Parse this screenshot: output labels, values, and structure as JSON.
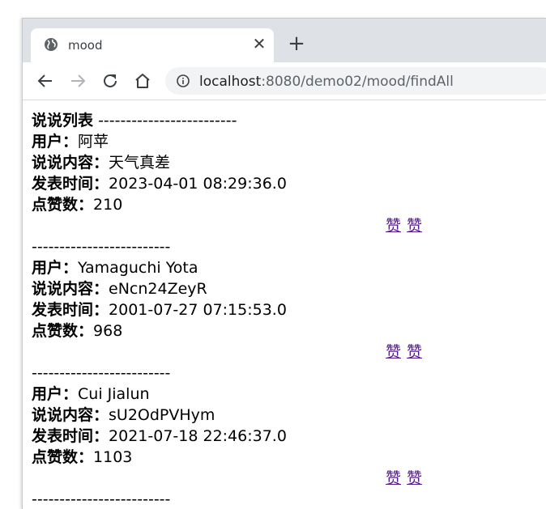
{
  "tab": {
    "title": "mood",
    "close_glyph": "✕",
    "new_tab_glyph": "+",
    "favicon": "globe-icon"
  },
  "toolbar": {
    "back_icon": "back-arrow-icon",
    "forward_icon": "forward-arrow-icon",
    "reload_icon": "reload-icon",
    "home_icon": "home-icon",
    "info_icon": "info-icon",
    "url_host": "localhost",
    "url_rest": ":8080/demo02/mood/findAll"
  },
  "page": {
    "list_title": "说说列表",
    "header_dashes": "-------------------------",
    "separator": "-------------------------",
    "labels": {
      "user": "用户：",
      "content": "说说内容：",
      "time": "发表时间：",
      "likes": "点赞数："
    },
    "like_link_1": "赞",
    "like_link_2": "赞",
    "posts": [
      {
        "user": "阿苹",
        "content": "天气真差",
        "time": "2023-04-01 08:29:36.0",
        "likes": "210"
      },
      {
        "user": "Yamaguchi Yota",
        "content": "eNcn24ZeyR",
        "time": "2001-07-27 07:15:53.0",
        "likes": "968"
      },
      {
        "user": "Cui Jialun",
        "content": "sU2OdPVHym",
        "time": "2021-07-18 22:46:37.0",
        "likes": "1103"
      }
    ]
  },
  "colors": {
    "link": "#551a8b",
    "tabstrip_bg": "#dee1e6",
    "omnibox_bg": "#f1f3f4"
  }
}
